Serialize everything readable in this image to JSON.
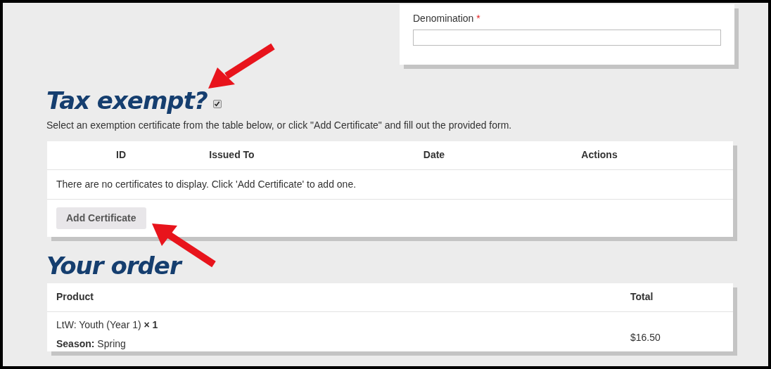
{
  "denomination_field": {
    "label": "Denomination",
    "required_mark": "*"
  },
  "tax_exempt": {
    "heading": "Tax exempt?",
    "checked": true,
    "instructions": "Select an exemption certificate from the table below, or click \"Add Certificate\" and fill out the provided form."
  },
  "certificates_table": {
    "columns": [
      "ID",
      "Issued To",
      "Date",
      "Actions"
    ],
    "empty_message": "There are no certificates to display. Click 'Add Certificate' to add one.",
    "add_button": "Add Certificate"
  },
  "order": {
    "heading": "Your order",
    "columns": [
      "Product",
      "Total"
    ],
    "rows": [
      {
        "product": "LtW: Youth (Year 1)  **× 1**",
        "meta": "**Season:** Spring",
        "total": "$16.50"
      }
    ]
  }
}
